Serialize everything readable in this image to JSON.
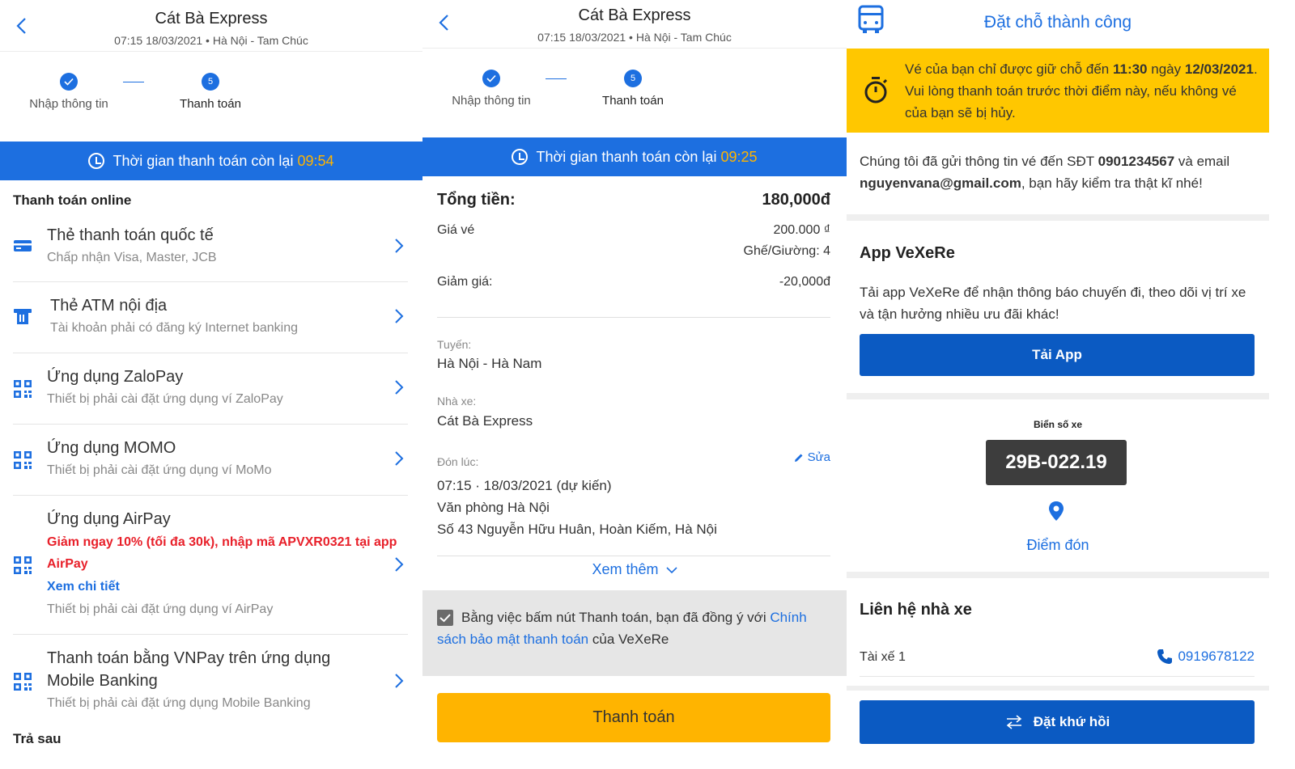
{
  "panel1": {
    "header": {
      "title": "Cát Bà Express",
      "subtitle": "07:15 18/03/2021 • Hà Nội - Tam Chúc"
    },
    "steps": [
      {
        "label": "Nhập thông tin",
        "badge": ""
      },
      {
        "label": "Thanh toán",
        "badge": "5"
      }
    ],
    "timer": {
      "text": "Thời gian thanh toán còn lại",
      "time": "09:54"
    },
    "section_online": "Thanh toán online",
    "methods": [
      {
        "title": "Thẻ thanh toán quốc tế",
        "sub": "Chấp nhận Visa, Master, JCB"
      },
      {
        "title": "Thẻ ATM nội địa",
        "sub": "Tài khoản phải có đăng ký Internet banking"
      },
      {
        "title": "Ứng dụng ZaloPay",
        "sub": "Thiết bị phải cài đặt ứng dụng ví ZaloPay"
      },
      {
        "title": "Ứng dụng MOMO",
        "sub": "Thiết bị phải cài đặt ứng dụng ví MoMo"
      },
      {
        "title": "Ứng dụng AirPay",
        "promo": "Giảm ngay 10% (tối đa 30k), nhập mã APVXR0321 tại app AirPay",
        "link": "Xem chi tiết",
        "sub": "Thiết bị phải cài đặt ứng dụng ví AirPay"
      },
      {
        "title_line1": "Thanh toán bằng VNPay trên ứng dụng",
        "title_line2": "Mobile Banking",
        "sub": "Thiết bị phải cài đặt ứng dụng Mobile Banking"
      }
    ],
    "section_later": "Trả sau"
  },
  "panel2": {
    "header": {
      "title": "Cát Bà Express",
      "subtitle": "07:15 18/03/2021 • Hà Nội - Tam Chúc"
    },
    "steps": [
      {
        "label": "Nhập thông tin",
        "badge": ""
      },
      {
        "label": "Thanh toán",
        "badge": "5"
      }
    ],
    "timer": {
      "text": "Thời gian thanh toán còn lại",
      "time": "09:25"
    },
    "total": {
      "label": "Tổng tiền:",
      "value": "180,000đ"
    },
    "ticket_price": {
      "label": "Giá vé",
      "value": "200.000 ₫",
      "seats": "Ghế/Giường: 4"
    },
    "discount": {
      "label": "Giảm giá:",
      "value": "-20,000đ"
    },
    "route": {
      "label": "Tuyến:",
      "value": "Hà Nội - Hà Nam"
    },
    "operator": {
      "label": "Nhà xe:",
      "value": "Cát Bà Express"
    },
    "pickup": {
      "label": "Đón lúc:",
      "edit": "Sửa",
      "time": "07:15 · 18/03/2021 (dự kiến)",
      "place": "Văn phòng Hà Nội",
      "address": "Số 43 Nguyễn Hữu Huân, Hoàn Kiếm, Hà Nội"
    },
    "see_more": "Xem thêm",
    "agree": {
      "pre": "Bằng việc bấm nút Thanh toán, bạn đã đồng ý với",
      "link": "Chính sách bảo mật thanh toán",
      "post": "của VeXeRe"
    },
    "pay_button": "Thanh toán"
  },
  "panel3": {
    "title": "Đặt chỗ thành công",
    "warning": {
      "p1": "Vé của bạn chỉ được giữ chỗ đến",
      "time": "11:30",
      "p2": "ngày",
      "date": "12/03/2021",
      "p3": ". Vui lòng thanh toán trước thời điểm này, nếu không vé của bạn sẽ bị hủy."
    },
    "sent": {
      "p1": "Chúng tôi đã gửi thông tin vé đến SĐT",
      "phone": "0901234567",
      "p2": "và email",
      "email": "nguyenvana@gmail.com",
      "p3": ", bạn hãy kiểm tra thật kĩ nhé!"
    },
    "app": {
      "title": "App VeXeRe",
      "desc": "Tải app VeXeRe để nhận thông báo chuyến đi, theo dõi vị trí xe và tận hưởng nhiều ưu đãi khác!",
      "button": "Tải App"
    },
    "plate": {
      "label": "Biển số xe",
      "value": "29B-022.19",
      "pickup_link": "Điểm đón"
    },
    "contact": {
      "title": "Liên hệ nhà xe",
      "driver": "Tài xế 1",
      "phone": "0919678122"
    },
    "return_button": "Đặt khứ hồi"
  },
  "colors": {
    "primary": "#1d6fe0",
    "accent": "#ffb400",
    "promo": "#e8202a",
    "warning_bg": "#ffc700",
    "button_dark": "#0b5ac2"
  }
}
